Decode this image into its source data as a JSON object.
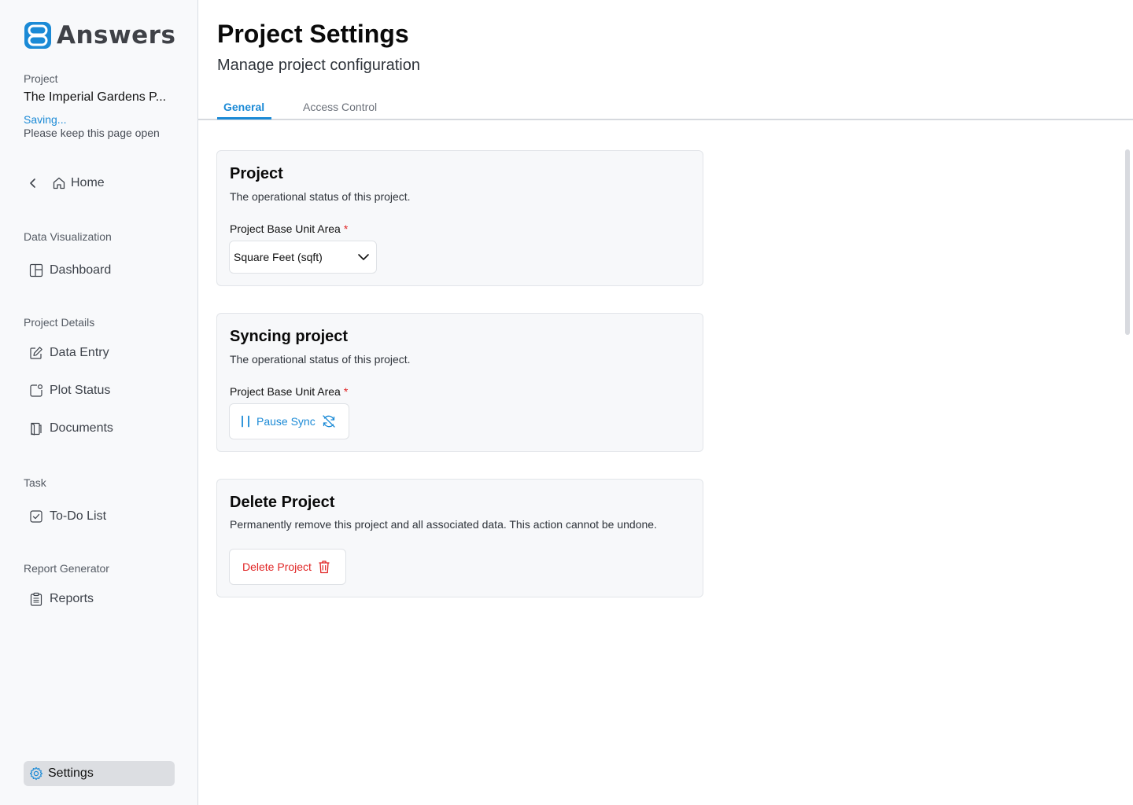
{
  "brand": {
    "name": "Answers",
    "accent": "#1b8ad6"
  },
  "sidebar": {
    "project_label": "Project",
    "project_name": "The Imperial Gardens P...",
    "saving_text": "Saving...",
    "keep_open_text": "Please keep this page open",
    "home_label": "Home",
    "sections": {
      "data_visualization": "Data Visualization",
      "project_details": "Project Details",
      "task": "Task",
      "report_generator": "Report Generator"
    },
    "items": {
      "dashboard": "Dashboard",
      "data_entry": "Data Entry",
      "plot_status": "Plot Status",
      "documents": "Documents",
      "todo": "To-Do List",
      "reports": "Reports",
      "settings": "Settings"
    }
  },
  "main": {
    "title": "Project Settings",
    "subtitle": "Manage project configuration",
    "tabs": {
      "general": "General",
      "access": "Access Control"
    },
    "cards": {
      "project": {
        "title": "Project",
        "description": "The operational status of this project.",
        "field_label": "Project Base Unit Area",
        "required_mark": "*",
        "select_value": "Square Feet (sqft)"
      },
      "syncing": {
        "title": "Syncing project",
        "description": "The operational status of this project.",
        "field_label": "Project Base Unit Area",
        "required_mark": "*",
        "button_label": "Pause Sync"
      },
      "delete": {
        "title": "Delete Project",
        "description": "Permanently remove this project and all associated data. This action cannot be undone.",
        "button_label": "Delete Project"
      }
    }
  },
  "colors": {
    "danger": "#e02424",
    "selected_bg": "#dcdee2"
  }
}
